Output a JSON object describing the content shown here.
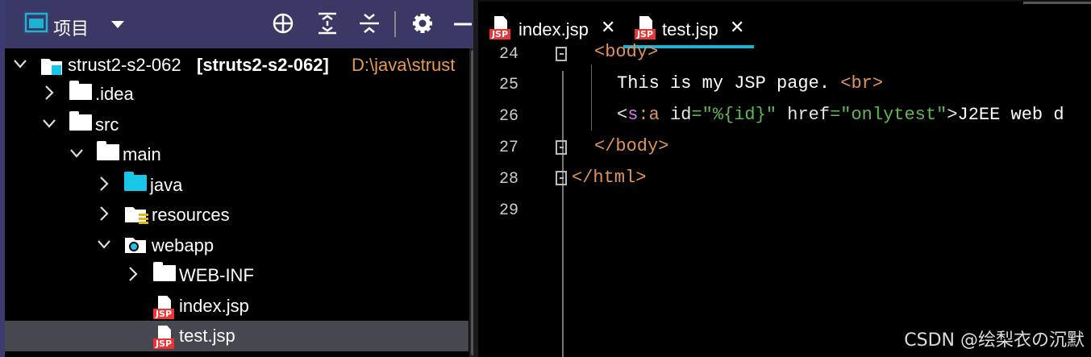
{
  "project_panel": {
    "title": "项目",
    "dropdown_icon": "caret-down-icon",
    "toolbar_icons": [
      "locate-icon",
      "expand-all-icon",
      "collapse-all-icon",
      "gear-icon",
      "minimize-icon"
    ]
  },
  "tree": {
    "root": {
      "name": "strust2-s2-062",
      "module": "[struts2-s2-062]",
      "path": "D:\\java\\strust"
    },
    "items": [
      {
        "label": ".idea"
      },
      {
        "label": "src"
      },
      {
        "label": "main"
      },
      {
        "label": "java"
      },
      {
        "label": "resources"
      },
      {
        "label": "webapp"
      },
      {
        "label": "WEB-INF"
      },
      {
        "label": "index.jsp"
      },
      {
        "label": "test.jsp"
      }
    ]
  },
  "tabs": [
    {
      "label": "index.jsp",
      "icon": "jsp-file-icon"
    },
    {
      "label": "test.jsp",
      "icon": "jsp-file-icon",
      "active": true
    }
  ],
  "editor": {
    "line_numbers": [
      "24",
      "25",
      "26",
      "27",
      "28",
      "29"
    ],
    "lines": {
      "l24": {
        "open": "<",
        "tag": "body",
        "close": ">"
      },
      "l25": {
        "text": "This is my JSP page. ",
        "br": "<br>"
      },
      "l26": {
        "lt": "<",
        "ns": "s",
        "colon": ":",
        "tag": "a",
        "attr1": " id",
        "eq1": "=",
        "val1": "\"%{id}\"",
        "attr2": " href",
        "eq2": "=",
        "val2": "\"onlytest\"",
        "gt": ">",
        "text": "J2EE web d"
      },
      "l27": {
        "tag": "</body>"
      },
      "l28": {
        "tag": "</html>"
      }
    }
  },
  "watermark": "CSDN @绘梨衣の沉默",
  "colors": {
    "accent": "#1bb2d6",
    "header_bg": "#3a3966",
    "tag": "#e0935a",
    "string": "#5fb852",
    "namespace": "#d77ae8",
    "selection": "#47474f"
  }
}
